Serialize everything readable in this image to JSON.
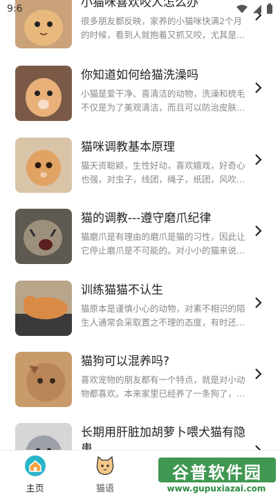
{
  "status_bar": {
    "time": "9:6"
  },
  "articles": [
    {
      "title": "小猫咪喜欢咬人怎么办",
      "desc": "很多朋友都反映，家养的小猫咪快满2个月的时候，看到人就抱着又抓又咬，尤其是..."
    },
    {
      "title": "你知道如何给猫洗澡吗",
      "desc": "小猫是爱干净、喜清洁的动物，洗澡和梳毛不仅是为了美观清洁，而且可以防治皮肤..."
    },
    {
      "title": "猫咪调教基本原理",
      "desc": "猫天资聪颖，生性好动，喜欢嬉戏，好奇心也强，对虫子，线团，绳子，纸团，风吹..."
    },
    {
      "title": "猫的调教---遵守磨爪纪律",
      "desc": "猫磨爪是有理由的磨爪是猫的习性，因此让它停止磨爪是不可能的。对小小的猫来说..."
    },
    {
      "title": "训练猫猫不认生",
      "desc": "猫原本是谨慎小心的动物，对素不相识的陌生人通常会采取置之不理的态度，有时还..."
    },
    {
      "title": "猫狗可以混养吗?",
      "desc": "喜欢宠物的朋友都有一个特点，就是对小动物都喜欢。本来家里已经养了一条狗了，..."
    },
    {
      "title": "长期用肝脏加胡萝卜喂犬猫有隐患",
      "desc": ""
    }
  ],
  "tabs": [
    {
      "label": "主页",
      "icon": "home-icon"
    },
    {
      "label": "猫语",
      "icon": "cat-face-icon"
    }
  ],
  "watermark": {
    "text": "谷普软件园",
    "url": "www.gupuxiazai.com"
  },
  "colors": {
    "tab_active": "#2bb5c9",
    "text_primary": "#222222",
    "text_secondary": "#888888"
  }
}
